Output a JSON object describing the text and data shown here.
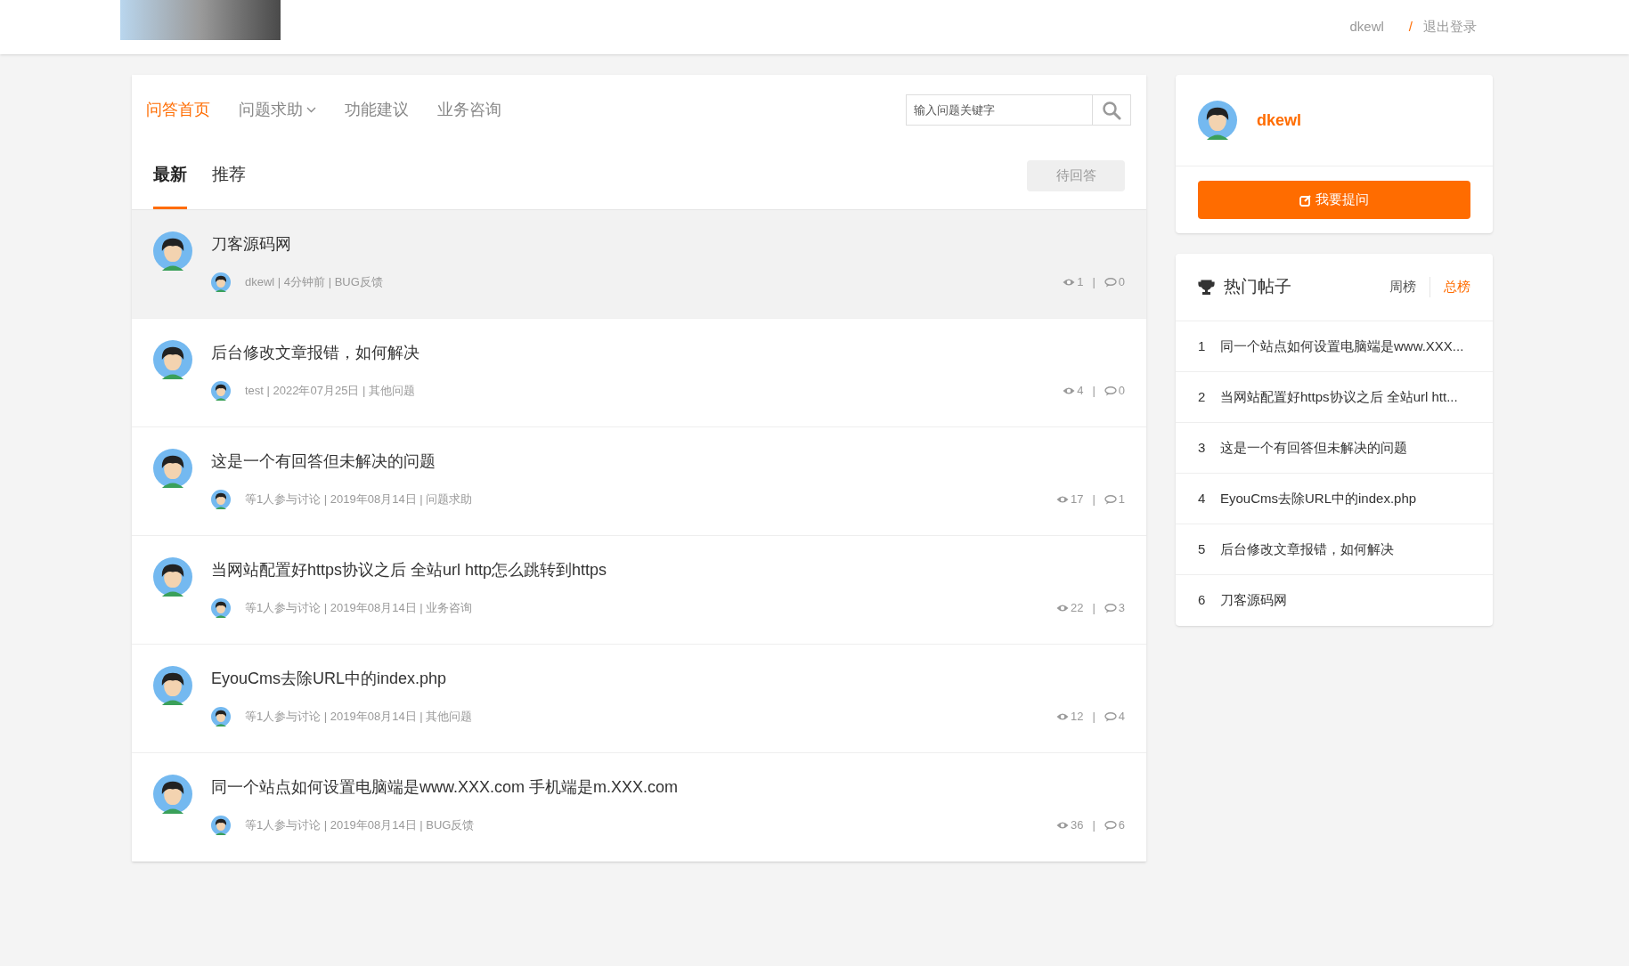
{
  "header": {
    "username": "dkewl",
    "separator": "/",
    "logout": "退出登录"
  },
  "nav": [
    {
      "label": "问答首页",
      "selected": true,
      "dropdown": false
    },
    {
      "label": "问题求助",
      "selected": false,
      "dropdown": true
    },
    {
      "label": "功能建议",
      "selected": false,
      "dropdown": false
    },
    {
      "label": "业务咨询",
      "selected": false,
      "dropdown": false
    }
  ],
  "search": {
    "placeholder": "输入问题关键字"
  },
  "tabs": [
    {
      "label": "最新",
      "selected": true
    },
    {
      "label": "推荐",
      "selected": false
    }
  ],
  "filter_button": "待回答",
  "questions": [
    {
      "title": "刀客源码网",
      "highlighted": true,
      "meta": "dkewl | 4分钟前 | BUG反馈",
      "views": "1",
      "separator": "|",
      "answers": "0"
    },
    {
      "title": "后台修改文章报错，如何解决",
      "highlighted": false,
      "meta": "test | 2022年07月25日 | 其他问题",
      "views": "4",
      "separator": "|",
      "answers": "0"
    },
    {
      "title": "这是一个有回答但未解决的问题",
      "highlighted": false,
      "meta": "等1人参与讨论 | 2019年08月14日 | 问题求助",
      "views": "17",
      "separator": "|",
      "answers": "1"
    },
    {
      "title": "当网站配置好https协议之后 全站url http怎么跳转到https",
      "highlighted": false,
      "meta": "等1人参与讨论 | 2019年08月14日 | 业务咨询",
      "views": "22",
      "separator": "|",
      "answers": "3"
    },
    {
      "title": "EyouCms去除URL中的index.php",
      "highlighted": false,
      "meta": "等1人参与讨论 | 2019年08月14日 | 其他问题",
      "views": "12",
      "separator": "|",
      "answers": "4"
    },
    {
      "title": "同一个站点如何设置电脑端是www.XXX.com 手机端是m.XXX.com",
      "highlighted": false,
      "meta": "等1人参与讨论 | 2019年08月14日 | BUG反馈",
      "views": "36",
      "separator": "|",
      "answers": "6"
    }
  ],
  "profile": {
    "username": "dkewl",
    "ask_button": "我要提问"
  },
  "hot": {
    "title": "热门帖子",
    "tabs": [
      {
        "label": "周榜",
        "selected": false
      },
      {
        "label": "总榜",
        "selected": true
      }
    ],
    "items": [
      {
        "rank": "1",
        "title": "同一个站点如何设置电脑端是www.XXX..."
      },
      {
        "rank": "2",
        "title": "当网站配置好https协议之后 全站url htt..."
      },
      {
        "rank": "3",
        "title": "这是一个有回答但未解决的问题"
      },
      {
        "rank": "4",
        "title": "EyouCms去除URL中的index.php"
      },
      {
        "rank": "5",
        "title": "后台修改文章报错，如何解决"
      },
      {
        "rank": "6",
        "title": "刀客源码网"
      }
    ]
  }
}
